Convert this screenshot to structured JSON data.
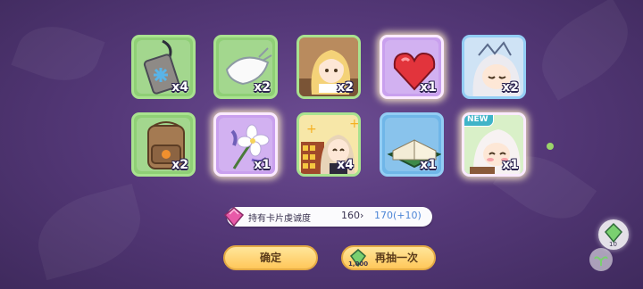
{
  "items_row1": [
    {
      "name": "charm",
      "icon": "snowflake-charm-icon",
      "quantity": "x4",
      "frame": "green"
    },
    {
      "name": "cloth",
      "icon": "white-cloth-bundle-icon",
      "quantity": "x2",
      "frame": "green"
    },
    {
      "name": "character-card-scene",
      "icon": "blonde-girl-card-icon",
      "quantity": "x2",
      "frame": "green"
    },
    {
      "name": "red-gem",
      "icon": "red-heart-gem-icon",
      "quantity": "x1",
      "frame": "purple"
    },
    {
      "name": "character-card-sleeping",
      "icon": "sleeping-girl-card-icon",
      "quantity": "x2",
      "frame": "blue"
    }
  ],
  "items_row2": [
    {
      "name": "backpack",
      "icon": "brown-backpack-icon",
      "quantity": "x2",
      "frame": "green"
    },
    {
      "name": "flower",
      "icon": "white-flower-icon",
      "quantity": "x1",
      "frame": "purple"
    },
    {
      "name": "character-card-happy",
      "icon": "happy-girl-card-icon",
      "quantity": "x4",
      "frame": "green"
    },
    {
      "name": "book",
      "icon": "green-open-book-icon",
      "quantity": "x1",
      "frame": "blue"
    },
    {
      "name": "character-card-new",
      "icon": "smiling-girl-card-icon",
      "quantity": "x1",
      "frame": "purple",
      "badge": "NEW"
    }
  ],
  "affection": {
    "label": "持有卡片虔诚度",
    "current": "160",
    "arrow": "›",
    "next": "170(+10)"
  },
  "buttons": {
    "confirm": "确定",
    "redraw": "再抽一次",
    "redraw_cost": "1,000"
  },
  "side_orb": {
    "count": "10"
  }
}
